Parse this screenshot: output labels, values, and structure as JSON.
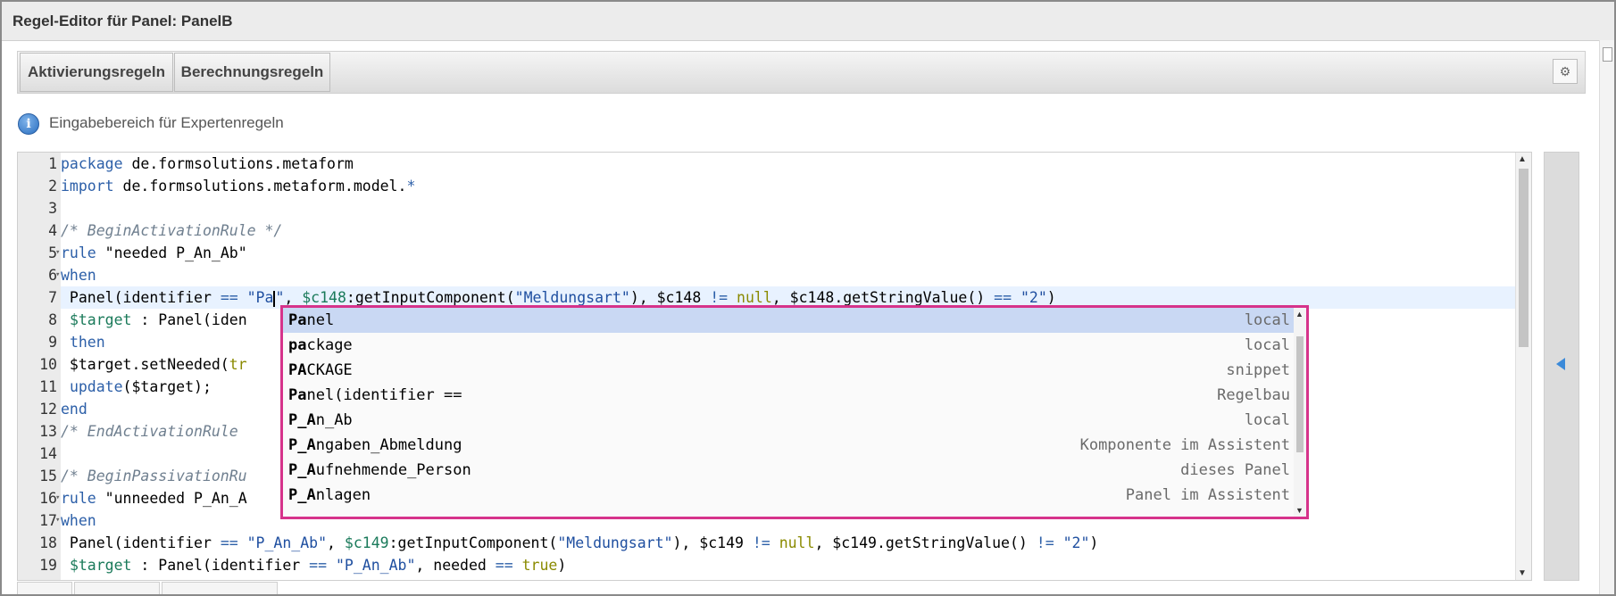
{
  "window": {
    "title": "Regel-Editor für Panel: PanelB"
  },
  "tabs": [
    {
      "label": "Aktivierungsregeln"
    },
    {
      "label": "Berechnungsregeln"
    }
  ],
  "settings_icon": "gear-icon",
  "info": {
    "icon": "info-icon",
    "text": "Eingabebereich für Expertenregeln"
  },
  "editor": {
    "active_line": 7,
    "lines": [
      {
        "n": "1",
        "text": "package de.formsolutions.metaform"
      },
      {
        "n": "2",
        "text": "import de.formsolutions.metaform.model.*"
      },
      {
        "n": "3",
        "text": ""
      },
      {
        "n": "4",
        "text": "/* BeginActivationRule */"
      },
      {
        "n": "5",
        "text": "rule \"needed P_An_Ab\""
      },
      {
        "n": "6",
        "text": "when"
      },
      {
        "n": "7",
        "text": " Panel(identifier == \"Pa\", $c148:getInputComponent(\"Meldungsart\"), $c148 != null, $c148.getStringValue() == \"2\")"
      },
      {
        "n": "8",
        "text": " $target : Panel(iden"
      },
      {
        "n": "9",
        "text": " then"
      },
      {
        "n": "10",
        "text": " $target.setNeeded(tr"
      },
      {
        "n": "11",
        "text": " update($target);"
      },
      {
        "n": "12",
        "text": "end"
      },
      {
        "n": "13",
        "text": "/* EndActivationRule"
      },
      {
        "n": "14",
        "text": ""
      },
      {
        "n": "15",
        "text": "/* BeginPassivationRu"
      },
      {
        "n": "16",
        "text": "rule \"unneeded P_An_A"
      },
      {
        "n": "17",
        "text": "when"
      },
      {
        "n": "18",
        "text": " Panel(identifier == \"P_An_Ab\", $c149:getInputComponent(\"Meldungsart\"), $c149 != null, $c149.getStringValue() != \"2\")"
      },
      {
        "n": "19",
        "text": " $target : Panel(identifier == \"P_An_Ab\", needed == true)"
      }
    ]
  },
  "autocomplete": {
    "items": [
      {
        "match": "Pa",
        "rest": "nel",
        "meta": "local",
        "selected": true
      },
      {
        "match": "pa",
        "rest": "ckage",
        "meta": "local"
      },
      {
        "match": "PA",
        "rest": "CKAGE",
        "meta": "snippet"
      },
      {
        "match": "Pa",
        "rest": "nel(identifier ==",
        "meta": "Regelbau"
      },
      {
        "match": "P_A",
        "rest": "n_Ab",
        "meta": "local"
      },
      {
        "match": "P_A",
        "rest": "ngaben_Abmeldung",
        "meta": "Komponente im Assistent"
      },
      {
        "match": "P_A",
        "rest": "ufnehmende_Person",
        "meta": "dieses Panel"
      },
      {
        "match": "P_A",
        "rest": "nlagen",
        "meta": "Panel im Assistent"
      }
    ]
  },
  "colors": {
    "highlight_border": "#d6338b",
    "selected_row": "#c9d8f3",
    "active_line": "#e8f2ff"
  }
}
